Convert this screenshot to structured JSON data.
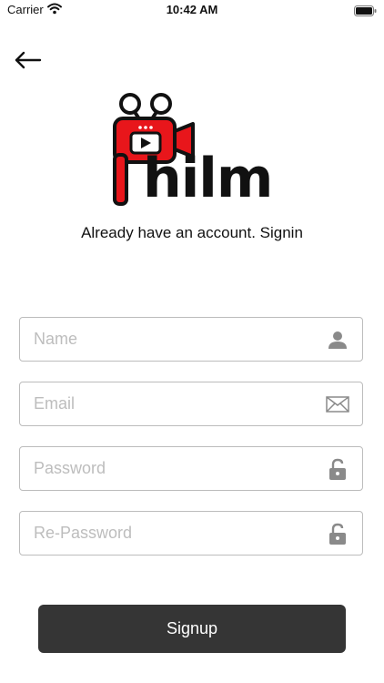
{
  "status_bar": {
    "carrier": "Carrier",
    "time": "10:42 AM",
    "wifi_icon": "wifi-icon",
    "battery_icon": "battery-icon"
  },
  "navigation": {
    "back_icon": "arrow-left-icon"
  },
  "logo": {
    "text": "hilm",
    "brand_color": "#E8161B",
    "dark_color": "#111111"
  },
  "signin_prompt": "Already have an account. Signin",
  "form": {
    "name": {
      "placeholder": "Name",
      "value": "",
      "icon": "user-icon"
    },
    "email": {
      "placeholder": "Email",
      "value": "",
      "icon": "mail-icon"
    },
    "password": {
      "placeholder": "Password",
      "value": "",
      "icon": "unlock-icon"
    },
    "repassword": {
      "placeholder": "Re-Password",
      "value": "",
      "icon": "unlock-icon"
    }
  },
  "signup_button": {
    "label": "Signup",
    "color": "#353535"
  }
}
